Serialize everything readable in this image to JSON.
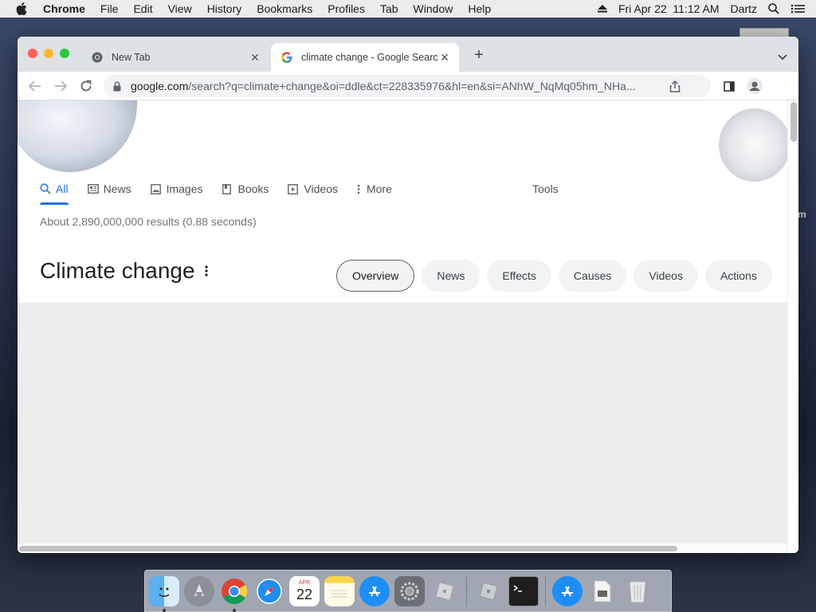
{
  "menubar": {
    "app_name": "Chrome",
    "items": [
      "File",
      "Edit",
      "View",
      "History",
      "Bookmarks",
      "Profiles",
      "Tab",
      "Window",
      "Help"
    ],
    "datetime": "Fri Apr 22  11:12 AM",
    "user": "Dartz"
  },
  "tabs": [
    {
      "title": "New Tab",
      "favicon": "chrome-icon"
    },
    {
      "title": "climate change - Google Search",
      "favicon": "google-g-icon"
    }
  ],
  "omnibox": {
    "host": "google.com",
    "path": "/search?q=climate+change&oi=ddle&ct=228335976&hl=en&si=ANhW_NqMq05hm_NHa..."
  },
  "search_tabs": {
    "all": "All",
    "news": "News",
    "images": "Images",
    "books": "Books",
    "videos": "Videos",
    "more": "More",
    "tools": "Tools"
  },
  "result_stats": "About 2,890,000,000 results (0.88 seconds)",
  "knowledge_panel": {
    "title": "Climate change",
    "chips": [
      "Overview",
      "News",
      "Effects",
      "Causes",
      "Videos",
      "Actions"
    ],
    "selected_chip": "Overview"
  },
  "dock": {
    "calendar_month": "APR",
    "calendar_day": "22"
  },
  "colors": {
    "link_blue": "#1a73e8",
    "close": "#ff5f57",
    "minimize": "#febc2e",
    "zoom": "#28c840"
  }
}
